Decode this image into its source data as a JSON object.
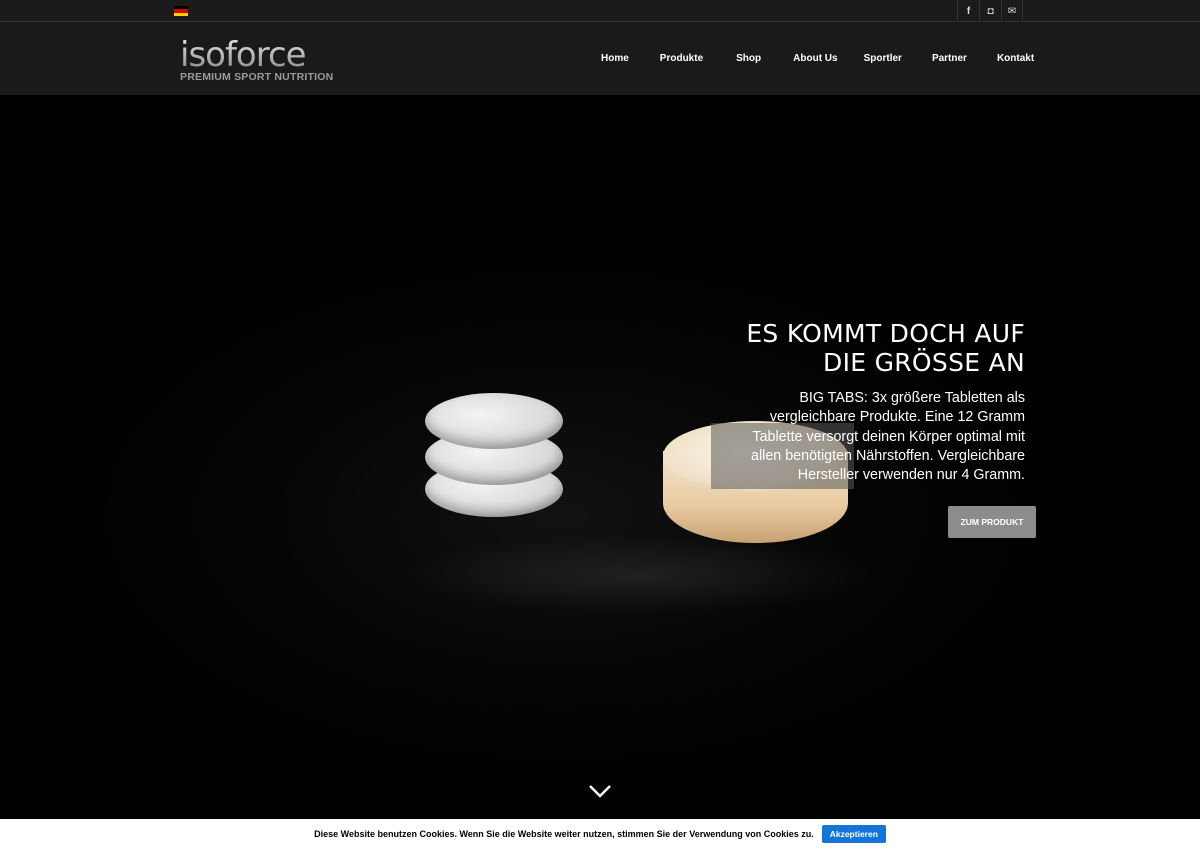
{
  "topbar": {
    "language_flag": "de-flag-icon",
    "flag_colors": [
      "#000000",
      "#dd0000",
      "#ffce00"
    ],
    "social": [
      {
        "icon": "facebook-icon",
        "glyph": "f"
      },
      {
        "icon": "instagram-icon",
        "glyph": "◘"
      },
      {
        "icon": "mail-icon",
        "glyph": "✉"
      }
    ]
  },
  "header": {
    "logo": {
      "wordmark": "isoforce",
      "tagline": "PREMIUM SPORT NUTRITION"
    },
    "nav": [
      "Home",
      "Produkte",
      "Shop",
      "About Us",
      "Sportler",
      "Partner",
      "Kontakt"
    ]
  },
  "hero": {
    "title_line1": "ES KOMMT DOCH AUF",
    "title_line2": "DIE GRÖSSE AN",
    "text": "BIG TABS: 3x größere Tabletten als vergleichbare Produkte. Eine 12 Gramm Tablette versorgt deinen Körper optimal mit allen benötigten Nährstoffen. Vergleichbare Hersteller verwenden nur 4 Gramm.",
    "cta_label": "ZUM PRODUKT",
    "scroll_icon": "chevron-down-icon"
  },
  "cookie": {
    "text": "Diese Website benutzen Cookies. Wenn Sie die Website weiter nutzen, stimmen Sie der Verwendung von Cookies zu.",
    "accept_label": "Akzeptieren",
    "accent_color": "#1475d8"
  }
}
